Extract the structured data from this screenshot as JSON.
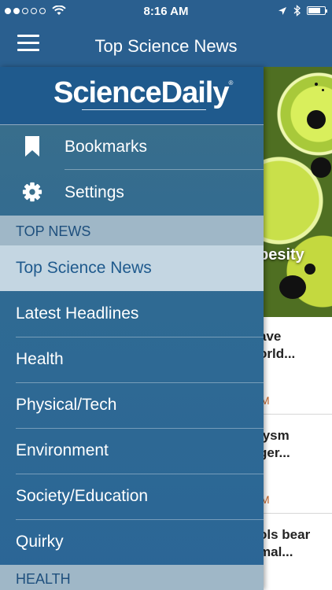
{
  "status_bar": {
    "time": "8:16 AM"
  },
  "nav_bar": {
    "title": "Top Science News"
  },
  "drawer": {
    "logo": "ScienceDaily",
    "logo_mark": "®",
    "utility_items": [
      {
        "label": "Bookmarks",
        "icon": "bookmark-icon"
      },
      {
        "label": "Settings",
        "icon": "gear-icon"
      }
    ],
    "sections": [
      {
        "header": "TOP NEWS",
        "items": [
          {
            "label": "Top Science News",
            "active": true
          },
          {
            "label": "Latest Headlines",
            "active": false
          },
          {
            "label": "Health",
            "active": false
          },
          {
            "label": "Physical/Tech",
            "active": false
          },
          {
            "label": "Environment",
            "active": false
          },
          {
            "label": "Society/Education",
            "active": false
          },
          {
            "label": "Quirky",
            "active": false
          }
        ]
      },
      {
        "header": "HEALTH",
        "items": []
      }
    ]
  },
  "background_content": {
    "hero_caption": "besity",
    "cards": [
      {
        "title": "ave\norld...",
        "meta": "M"
      },
      {
        "title": "lysm\nger...",
        "meta": "M"
      },
      {
        "title": "ols bear\nmal...",
        "meta": ""
      }
    ]
  },
  "colors": {
    "bar": "#2a5f8f",
    "active_item_bg": "#c4d6e2",
    "section_header_bg": "#9fb7c7",
    "meta_accent": "#c0632a"
  }
}
